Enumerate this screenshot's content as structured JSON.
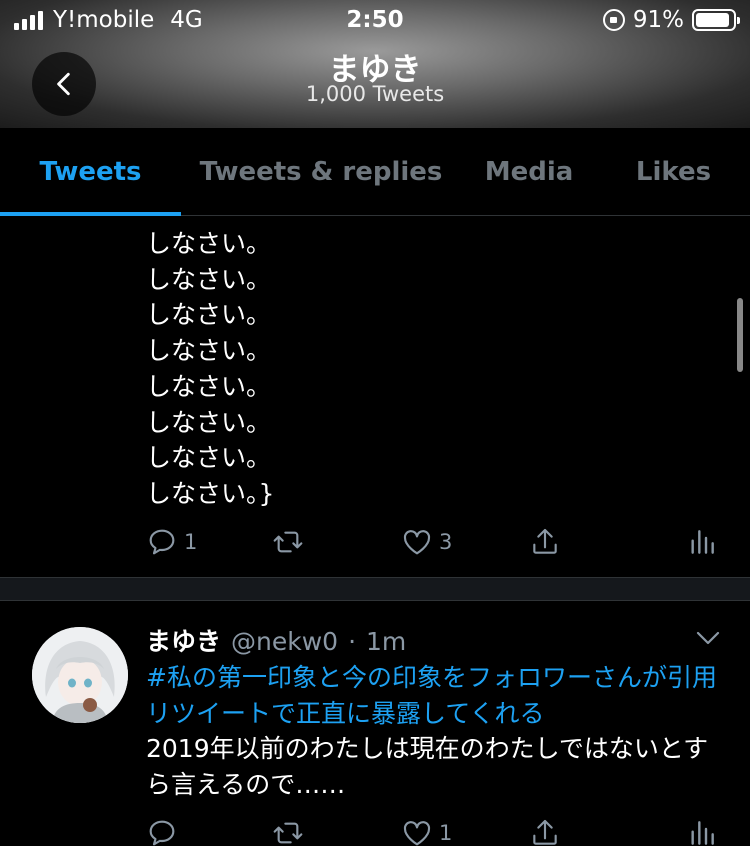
{
  "status_bar": {
    "carrier": "Y!mobile",
    "network": "4G",
    "time": "2:50",
    "battery": "91%",
    "battery_level": 0.91,
    "icons": [
      "signal-icon",
      "orientation-lock-icon",
      "battery-icon"
    ]
  },
  "header": {
    "back_icon": "chevron-left-icon",
    "name": "まゆき",
    "tweet_count": "1,000 Tweets"
  },
  "tabs": [
    {
      "label": "Tweets",
      "active": true
    },
    {
      "label": "Tweets & replies",
      "active": false
    },
    {
      "label": "Media",
      "active": false
    },
    {
      "label": "Likes",
      "active": false
    }
  ],
  "tweet1": {
    "lines": [
      "しなさい。",
      "しなさい。",
      "しなさい。",
      "しなさい。",
      "しなさい。",
      "しなさい。",
      "しなさい。",
      "しなさい。}"
    ],
    "reply_count": "1",
    "retweet_count": "",
    "like_count": "3"
  },
  "tweet2": {
    "name": "まゆき",
    "handle": "@nekw0",
    "separator": "·",
    "time_ago": "1m",
    "hashtag": "#私の第一印象と今の印象をフォロワーさんが引用リツイートで正直に暴露してくれる",
    "text": "2019年以前のわたしは現在のわたしではないとすら言えるので……",
    "reply_count": "",
    "retweet_count": "",
    "like_count": "1"
  },
  "colors": {
    "accent": "#1da1f2",
    "muted": "#8b98a5",
    "background": "#000000"
  }
}
